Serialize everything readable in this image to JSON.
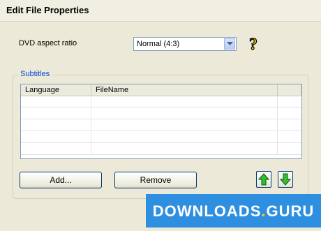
{
  "window": {
    "title": "Edit File Properties"
  },
  "aspect": {
    "label": "DVD aspect ratio",
    "selected": "Normal (4:3)",
    "help_icon": "question-mark-icon"
  },
  "subtitles": {
    "group_label": "Subtitles",
    "columns": [
      "Language",
      "FileName"
    ],
    "rows": [
      [
        "",
        ""
      ],
      [
        "",
        ""
      ],
      [
        "",
        ""
      ],
      [
        "",
        ""
      ],
      [
        "",
        ""
      ]
    ]
  },
  "buttons": {
    "add": "Add...",
    "remove": "Remove",
    "move_up_icon": "green-up-arrow-icon",
    "move_down_icon": "green-down-arrow-icon"
  },
  "watermark": {
    "left": "DOWNLOADS",
    "dot": ".",
    "right": "GURU"
  },
  "colors": {
    "group_label": "#0046d5",
    "arrow_green": "#2fbf2f",
    "watermark_bg": "#2e8fe0"
  }
}
